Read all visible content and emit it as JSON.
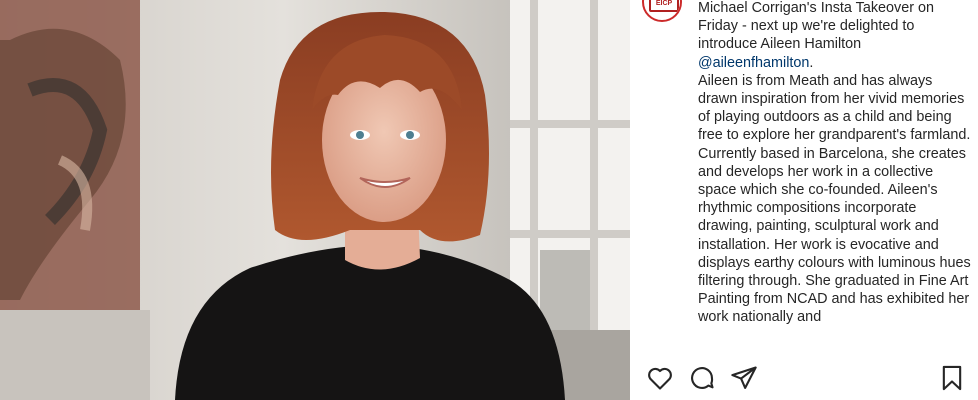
{
  "post": {
    "image": {
      "description_icon": "portrait-photo"
    },
    "author_avatar": {
      "icon": "logo-icon",
      "text": "EICP"
    },
    "caption": {
      "line_prefix": "Michael Corrigan's Insta Takeover on Friday - next up we're delighted to introduce Aileen Hamilton",
      "mention": "@aileenfhamilton",
      "mention_suffix": ".",
      "body": "Aileen is from Meath and has always drawn inspiration from her vivid memories of playing outdoors as a child and being free to explore her grandparent's farmland. Currently based in Barcelona, she creates and develops her work in a collective space which she co-founded. Aileen's rhythmic compositions incorporate drawing, painting, sculptural work and installation. Her work is evocative and displays earthy colours with luminous hues filtering through. She graduated in Fine Art Painting from NCAD and has exhibited her work nationally and"
    },
    "actions": {
      "like": "heart-icon",
      "comment": "comment-icon",
      "share": "share-icon",
      "save": "bookmark-icon"
    },
    "colors": {
      "text": "#262626",
      "mention": "#00376b",
      "avatar_ring": "#cc2a2a"
    }
  }
}
